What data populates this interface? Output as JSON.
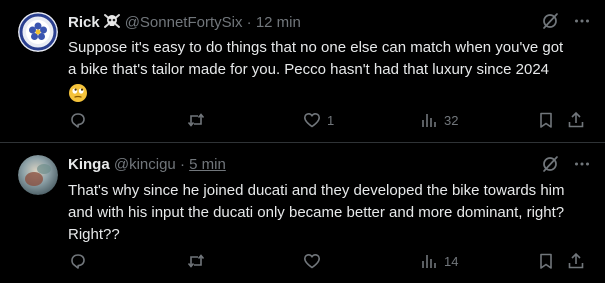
{
  "tweets": [
    {
      "display_name": "Rick",
      "handle": "@SonnetFortySix",
      "separator": "·",
      "time": "12 min",
      "text_lines": [
        "Suppose it's easy to do things that no one else can match when you've got",
        "a bike that's tailor made for you. Pecco hasn't had that luxury since 2024"
      ],
      "name_icon": "skull-crossbones-icon",
      "emoji": "rolling-eyes-emoji",
      "replies": "",
      "reposts": "",
      "likes": "1",
      "views": "32"
    },
    {
      "display_name": "Kinga",
      "handle": "@kincigu",
      "separator": "·",
      "time": "5 min",
      "text_lines": [
        "That's why since he joined ducati and they developed the bike towards him",
        "and with his input the ducati only became better and more dominant, right?",
        "Right??"
      ],
      "replies": "",
      "reposts": "",
      "likes": "",
      "views": "14"
    }
  ],
  "colors": {
    "background": "#000000",
    "text": "#e7e9ea",
    "muted": "#71767b",
    "divider": "#2f3336"
  }
}
